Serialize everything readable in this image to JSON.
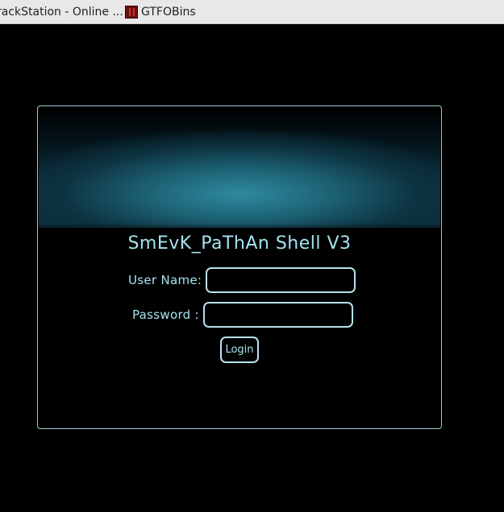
{
  "bookmarks": {
    "items": [
      {
        "label": "rackStation - Online ...",
        "icon": "page-icon"
      },
      {
        "label": "GTFOBins",
        "icon": "gtfobins-favicon-icon"
      }
    ]
  },
  "login": {
    "title": "SmEvK_PaThAn Shell V3",
    "username_label": "User Name:",
    "username_value": "",
    "password_label": "Password :",
    "password_value": "",
    "submit_label": "Login"
  },
  "colors": {
    "page_background": "#000000",
    "accent_text": "#a6e3f0",
    "border": "#b8e2ec",
    "banner": "#1c6173"
  }
}
